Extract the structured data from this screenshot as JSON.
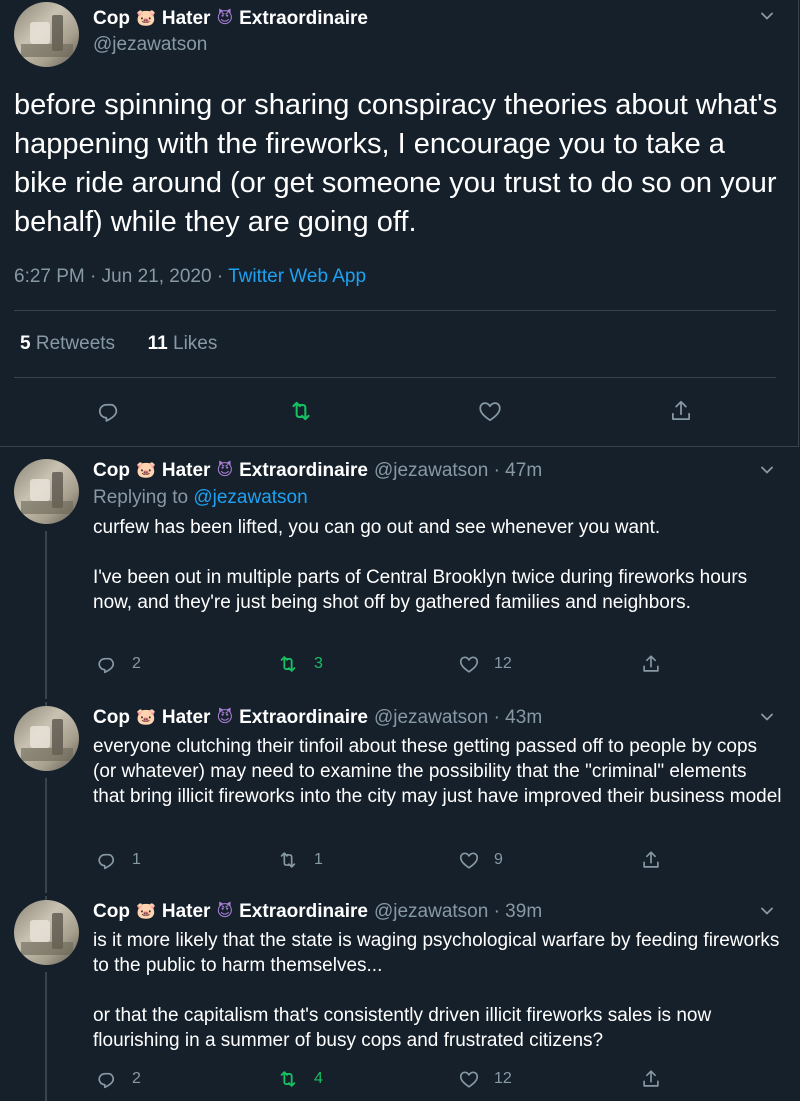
{
  "main_tweet": {
    "display_name": "Cop",
    "name_part2": "Hater",
    "name_part3": "Extraordinaire",
    "emoji1": "🐷",
    "emoji2": "😈",
    "handle": "@jezawatson",
    "text": "before spinning or sharing conspiracy theories about what's happening with the fireworks, I encourage you to take a bike ride around (or get someone you trust to do so on your behalf) while they are going off.",
    "time": "6:27 PM",
    "date": "Jun 21, 2020",
    "separator": "·",
    "client": "Twitter Web App",
    "retweets_count": "5",
    "retweets_label": "Retweets",
    "likes_count": "11",
    "likes_label": "Likes"
  },
  "replies": [
    {
      "display_name": "Cop",
      "name_part2": "Hater",
      "name_part3": "Extraordinaire",
      "handle_time": "@jezawatson · 47m",
      "replying_prefix": "Replying to",
      "replying_to": "@jezawatson",
      "text": "curfew has been lifted, you can go out and see whenever you want.\n\nI've been out in multiple parts of Central Brooklyn twice during fireworks hours now, and they're just being shot off by gathered families and neighbors.",
      "reply_count": "2",
      "retweet_count": "3",
      "like_count": "12",
      "retweeted": true
    },
    {
      "display_name": "Cop",
      "name_part2": "Hater",
      "name_part3": "Extraordinaire",
      "handle_time": "@jezawatson · 43m",
      "text": "everyone clutching their tinfoil about these getting passed off to people by cops (or whatever) may need to examine the possibility that the \"criminal\" elements that bring illicit fireworks into the city may just have improved their business model",
      "reply_count": "1",
      "retweet_count": "1",
      "like_count": "9",
      "retweeted": false
    },
    {
      "display_name": "Cop",
      "name_part2": "Hater",
      "name_part3": "Extraordinaire",
      "handle_time": "@jezawatson · 39m",
      "text": "is it more likely that the state is waging psychological warfare by feeding fireworks to the public to harm themselves...\n\nor that the capitalism that's consistently driven illicit fireworks sales is now flourishing in a summer of busy cops and frustrated citizens?",
      "reply_count": "2",
      "retweet_count": "4",
      "like_count": "12",
      "retweeted": true
    }
  ],
  "colors": {
    "background": "#15202b",
    "secondary_text": "#8899a6",
    "link": "#1da1f2",
    "retweet_green": "#17bf63",
    "border": "#38444d"
  },
  "icons": [
    "reply-icon",
    "retweet-icon",
    "like-icon",
    "share-icon",
    "chevron-down-icon"
  ]
}
